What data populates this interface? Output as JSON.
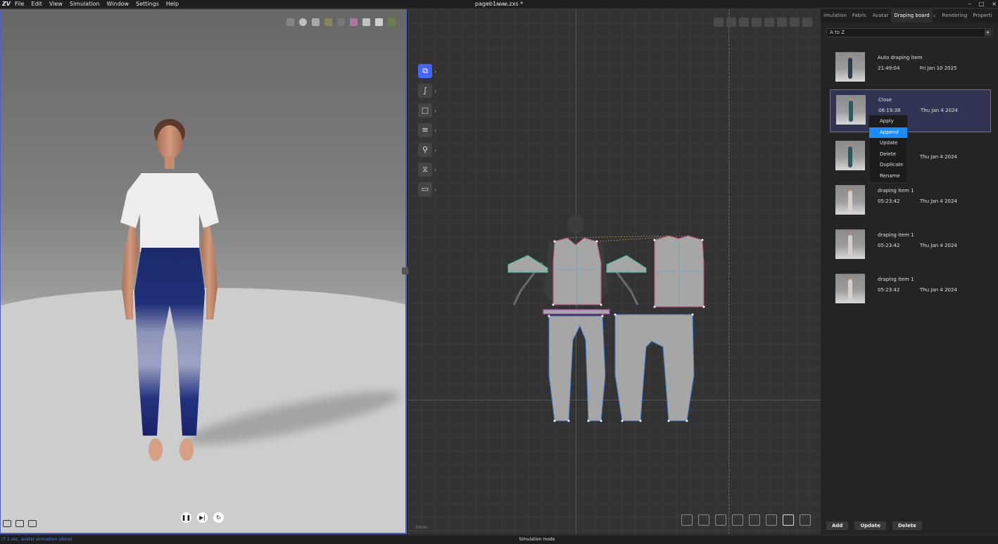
{
  "app": {
    "logo": "ZV",
    "window_title": "pageb1ꦤꦤ.zxs *",
    "menu": [
      "File",
      "Edit",
      "View",
      "Simulation",
      "Window",
      "Settings",
      "Help"
    ],
    "window_controls": [
      "–",
      "□",
      "×"
    ]
  },
  "viewport3d": {
    "playback": {
      "pause": "❚❚",
      "step": "▶|",
      "reset": "↻"
    }
  },
  "pattern_window": {
    "scale_label": "10cm",
    "tools": [
      {
        "icon": "transform-pattern-icon",
        "glyph": "⧉"
      },
      {
        "icon": "curve-icon",
        "glyph": "∫"
      },
      {
        "icon": "rectangle-icon",
        "glyph": "□"
      },
      {
        "icon": "sewing-icon",
        "glyph": "≡"
      },
      {
        "icon": "pin-icon",
        "glyph": "⚲"
      },
      {
        "icon": "fold-icon",
        "glyph": "⧖"
      },
      {
        "icon": "layer-icon",
        "glyph": "▭"
      }
    ],
    "tool_arrow": "›"
  },
  "right_panel": {
    "tabs": [
      "imulation",
      "Fabric",
      "Avatar",
      "Draping board",
      "Rendering",
      "Properti"
    ],
    "active_tab": "Draping board",
    "tab_close": "×",
    "sort": {
      "value": "A to Z",
      "arrow": "▾"
    },
    "items": [
      {
        "name": "Auto draping item",
        "time": "21:49:04",
        "date": "Fri Jan 10 2025",
        "outfit": "dark"
      },
      {
        "name": "Close",
        "time": "06:19:38",
        "date": "Thu Jan 4 2024",
        "outfit": "teal",
        "selected": true
      },
      {
        "name": "",
        "time": "",
        "date": "Thu Jan 4 2024",
        "outfit": "teal"
      },
      {
        "name": "draping item 1",
        "time": "05:23:42",
        "date": "Thu Jan 4 2024",
        "outfit": "light"
      },
      {
        "name": "draping item 1",
        "time": "05:23:42",
        "date": "Thu Jan 4 2024",
        "outfit": "light"
      },
      {
        "name": "draping item 1",
        "time": "05:23:42",
        "date": "Thu Jan 4 2024",
        "outfit": "light"
      }
    ],
    "context_menu": [
      "Apply",
      "Append",
      "Update",
      "Delete",
      "Duplicate",
      "Rename"
    ],
    "context_highlight": "Append",
    "actions": {
      "add": "Add",
      "update": "Update",
      "delete": "Delete"
    }
  },
  "status": {
    "left": "(7.1 sec, avatar animation (done)",
    "center": "Simulation mode"
  },
  "colors": {
    "accent": "#4466ff",
    "selection_border": "#5d6ad8",
    "menu_highlight": "#1a8cff",
    "viewport_border": "#4b63c6"
  }
}
